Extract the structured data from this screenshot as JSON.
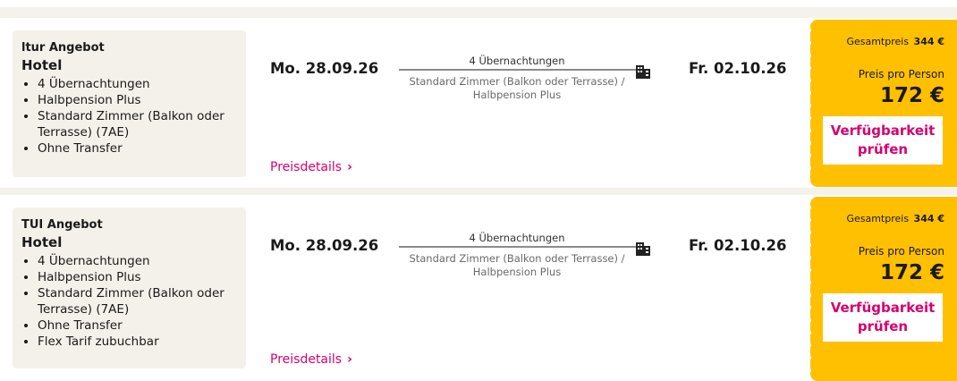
{
  "offers": [
    {
      "provider": "ltur Angebot",
      "title": "Hotel",
      "features": [
        "4 Übernachtungen",
        "Halbpension Plus",
        "Standard Zimmer (Balkon oder Terrasse) (7AE)",
        "Ohne Transfer"
      ],
      "departure": "Mo. 28.09.26",
      "return": "Fr. 02.10.26",
      "nights": "4 Übernachtungen",
      "room_line1": "Standard Zimmer (Balkon oder Terrasse) /",
      "room_line2": "Halbpension Plus",
      "details_label": "Preisdetails",
      "total_label": "Gesamtpreis",
      "total_value": "344 €",
      "per_person_label": "Preis pro Person",
      "per_person_value": "172 €",
      "availability_label": "Verfügbarkeit prüfen"
    },
    {
      "provider": "TUI Angebot",
      "title": "Hotel",
      "features": [
        "4 Übernachtungen",
        "Halbpension Plus",
        "Standard Zimmer (Balkon oder Terrasse) (7AE)",
        "Ohne Transfer",
        "Flex Tarif zubuchbar"
      ],
      "departure": "Mo. 28.09.26",
      "return": "Fr. 02.10.26",
      "nights": "4 Übernachtungen",
      "room_line1": "Standard Zimmer (Balkon oder Terrasse) /",
      "room_line2": "Halbpension Plus",
      "details_label": "Preisdetails",
      "total_label": "Gesamtpreis",
      "total_value": "344 €",
      "per_person_label": "Preis pro Person",
      "per_person_value": "172 €",
      "availability_label": "Verfügbarkeit prüfen"
    }
  ],
  "icons": {
    "hotel": "hotel-building-icon",
    "details": "chevron-right-icon"
  },
  "colors": {
    "accent": "#d6006e",
    "price_card": "#ffc002",
    "panel": "#f4f1ea"
  }
}
